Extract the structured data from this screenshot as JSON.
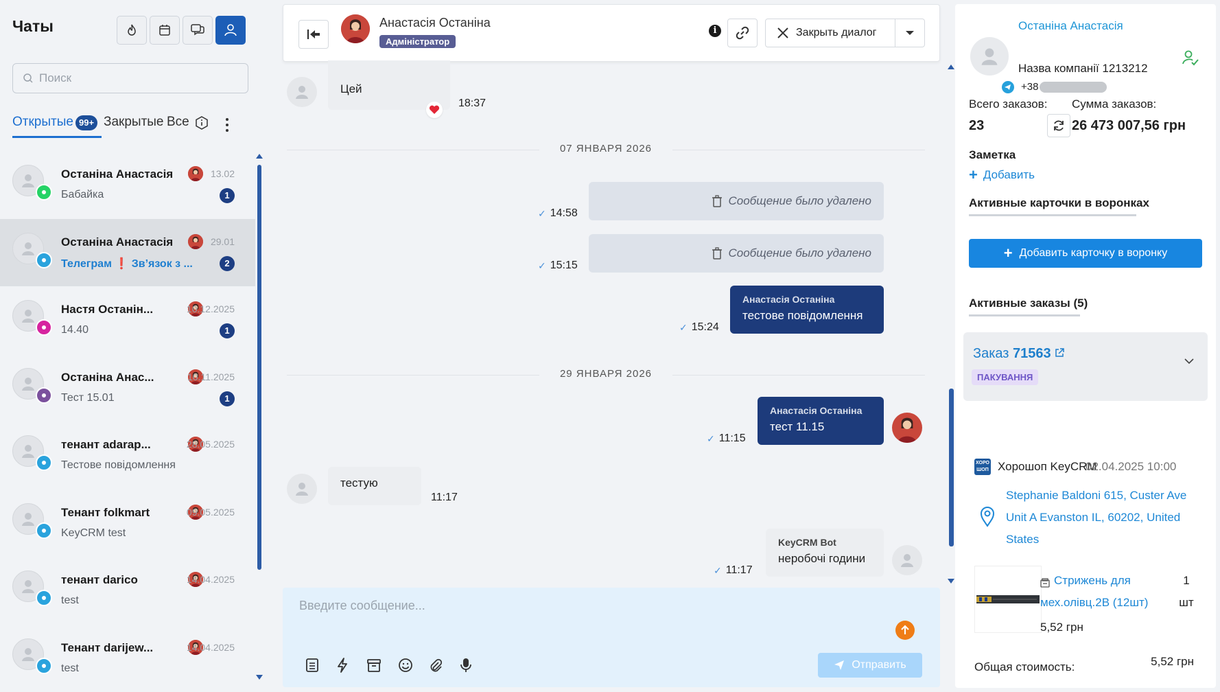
{
  "sidebar": {
    "title": "Чаты",
    "search_placeholder": "Поиск",
    "tabs": {
      "open": "Открытые",
      "open_badge": "99+",
      "closed": "Закрытые",
      "all": "Все"
    },
    "chats": [
      {
        "name": "Останіна Анастасія",
        "date": "13.02",
        "preview": "Бабайка",
        "unread": "1",
        "channel": "whatsapp-icon"
      },
      {
        "name": "Останіна Анастасія",
        "date": "29.01",
        "preview_parts": [
          "Телеграм",
          "❗",
          "Зв’язок з ..."
        ],
        "unread": "2",
        "channel": "telegram-icon"
      },
      {
        "name": "Настя Останін...",
        "date": "10.12.2025",
        "preview": "14.40",
        "unread": "1",
        "channel": "instagram-icon"
      },
      {
        "name": "Останіна Анас...",
        "date": "10.11.2025",
        "preview": "Тест 15.01",
        "unread": "1",
        "channel": "viber-icon"
      },
      {
        "name": "тенант adarap...",
        "date": "28.05.2025",
        "preview": "Тестове повідомлення",
        "channel": "telegram-icon"
      },
      {
        "name": "Тенант folkmart",
        "date": "09.05.2025",
        "preview": "KeyCRM test",
        "channel": "telegram-icon"
      },
      {
        "name": "тенант darico",
        "date": "14.04.2025",
        "preview": "test",
        "channel": "telegram-icon"
      },
      {
        "name": "Тенант darijew...",
        "date": "14.04.2025",
        "preview": "test",
        "channel": "telegram-icon"
      }
    ]
  },
  "header": {
    "name": "Анастасія Останіна",
    "role": "Адміністратор",
    "close_label": "Закрыть диалог"
  },
  "messages": {
    "m1": {
      "text": "Цей",
      "time": "18:37"
    },
    "date1": "07 ЯНВАРЯ 2026",
    "deleted1": {
      "text": "Сообщение было удалено",
      "time": "14:58"
    },
    "deleted2": {
      "text": "Сообщение было удалено",
      "time": "15:15"
    },
    "out1": {
      "sender": "Анастасія Останіна",
      "text": "тестове повідомлення",
      "time": "15:24"
    },
    "date2": "29 ЯНВАРЯ 2026",
    "out2": {
      "sender": "Анастасія Останіна",
      "text": "тест 11.15",
      "time": "11:15"
    },
    "in2": {
      "text": "тестую",
      "time": "11:17"
    },
    "bot": {
      "sender": "KeyCRM Bot",
      "text": "неробочі години",
      "time": "11:17"
    }
  },
  "composer": {
    "placeholder": "Введите сообщение...",
    "send_label": "Отправить"
  },
  "client": {
    "name": "Останіна Анастасія",
    "company": "Назва компанії 1213212",
    "phone_prefix": "+38",
    "total_orders_label": "Всего заказов:",
    "total_orders": "23",
    "sum_label": "Сумма заказов:",
    "sum": "26 473 007,56 грн",
    "note_label": "Заметка",
    "add_label": "Добавить",
    "cards_label": "Активные карточки в воронках",
    "add_card_label": "Добавить карточку в воронку",
    "orders_label": "Активные заказы (5)"
  },
  "order": {
    "prefix": "Заказ",
    "number": "71563",
    "status": "ПАКУВАННЯ",
    "shop_icon_text": "ХОРО ШОП",
    "shop": "Хорошоп KeyCRM",
    "date": "02.04.2025 10:00",
    "address": "Stephanie Baldoni 615, Custer Ave Unit A Evanston IL, 60202, United States",
    "product": "Стрижень для мех.олівц.2B (12шт)",
    "qty": "1 шт",
    "price": "5,52 грн",
    "total_label": "Общая стоимость:",
    "total": "5,52 грн"
  },
  "colors": {
    "primary": "#1d5eb7",
    "outgoing": "#1d3b7b",
    "accent": "#1886e0",
    "status": "#6e56c7"
  }
}
